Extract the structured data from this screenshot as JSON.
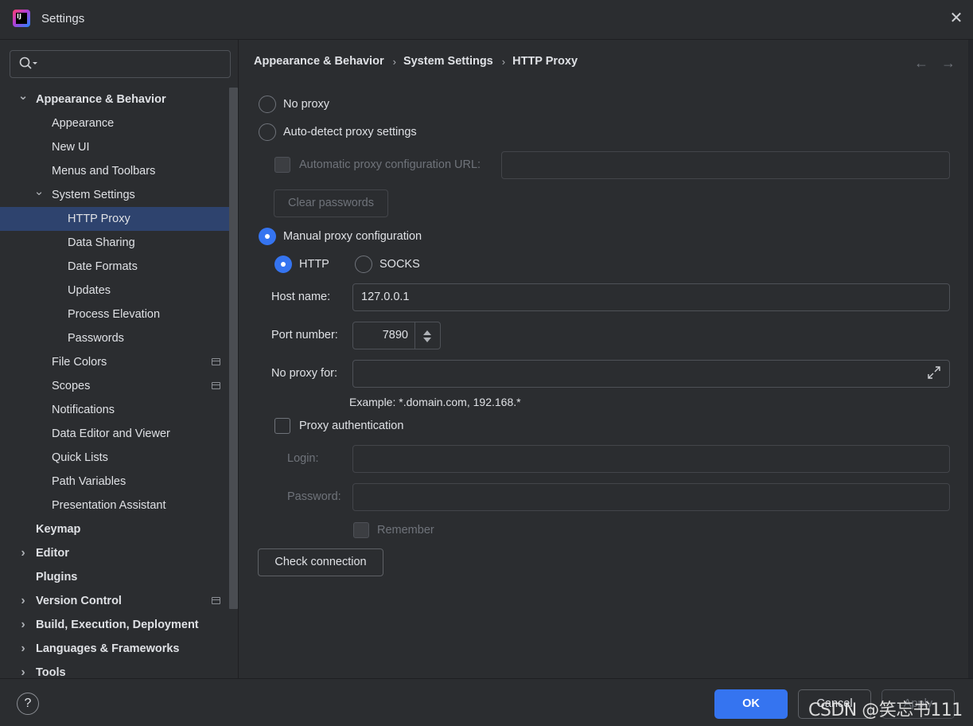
{
  "window": {
    "title": "Settings",
    "close_glyph": "✕"
  },
  "search": {
    "placeholder": "",
    "value": ""
  },
  "tree": [
    {
      "label": "Appearance & Behavior",
      "bold": true,
      "expanded": true,
      "level": 0
    },
    {
      "label": "Appearance",
      "level": 1
    },
    {
      "label": "New UI",
      "level": 1
    },
    {
      "label": "Menus and Toolbars",
      "level": 1
    },
    {
      "label": "System Settings",
      "expanded": true,
      "level": 1
    },
    {
      "label": "HTTP Proxy",
      "level": 2,
      "selected": true
    },
    {
      "label": "Data Sharing",
      "level": 2
    },
    {
      "label": "Date Formats",
      "level": 2
    },
    {
      "label": "Updates",
      "level": 2
    },
    {
      "label": "Process Elevation",
      "level": 2
    },
    {
      "label": "Passwords",
      "level": 2
    },
    {
      "label": "File Colors",
      "level": 1,
      "project_icon": true
    },
    {
      "label": "Scopes",
      "level": 1,
      "project_icon": true
    },
    {
      "label": "Notifications",
      "level": 1
    },
    {
      "label": "Data Editor and Viewer",
      "level": 1
    },
    {
      "label": "Quick Lists",
      "level": 1
    },
    {
      "label": "Path Variables",
      "level": 1
    },
    {
      "label": "Presentation Assistant",
      "level": 1
    },
    {
      "label": "Keymap",
      "bold": true,
      "level": 0
    },
    {
      "label": "Editor",
      "bold": true,
      "collapsed": true,
      "level": 0
    },
    {
      "label": "Plugins",
      "bold": true,
      "level": 0
    },
    {
      "label": "Version Control",
      "bold": true,
      "collapsed": true,
      "level": 0,
      "project_icon": true
    },
    {
      "label": "Build, Execution, Deployment",
      "bold": true,
      "collapsed": true,
      "level": 0
    },
    {
      "label": "Languages & Frameworks",
      "bold": true,
      "collapsed": true,
      "level": 0
    },
    {
      "label": "Tools",
      "bold": true,
      "collapsed": true,
      "level": 0
    }
  ],
  "breadcrumb": {
    "items": [
      "Appearance & Behavior",
      "System Settings",
      "HTTP Proxy"
    ],
    "separator": "›"
  },
  "nav": {
    "back_glyph": "←",
    "forward_glyph": "→"
  },
  "proxy": {
    "no_proxy_label": "No proxy",
    "auto_detect_label": "Auto-detect proxy settings",
    "auto_config_url_label": "Automatic proxy configuration URL:",
    "auto_config_url_value": "",
    "clear_passwords_label": "Clear passwords",
    "manual_label": "Manual proxy configuration",
    "selected_mode": "manual",
    "http_label": "HTTP",
    "socks_label": "SOCKS",
    "selected_type": "HTTP",
    "host_label": "Host name:",
    "host_value": "127.0.0.1",
    "port_label": "Port number:",
    "port_value": "7890",
    "no_proxy_for_label": "No proxy for:",
    "no_proxy_for_value": "",
    "example_text": "Example: *.domain.com, 192.168.*",
    "auth_label": "Proxy authentication",
    "login_label": "Login:",
    "login_value": "",
    "password_label": "Password:",
    "password_value": "",
    "remember_label": "Remember",
    "check_connection_label": "Check connection"
  },
  "footer": {
    "help_glyph": "?",
    "ok_label": "OK",
    "cancel_label": "Cancel",
    "apply_label": "Apply"
  },
  "watermark": "CSDN @笑忘书111",
  "colors": {
    "accent": "#3574f0",
    "background": "#2b2d30",
    "selection": "#2e436e",
    "text": "#dfe1e5",
    "disabled_text": "#6f737a"
  }
}
